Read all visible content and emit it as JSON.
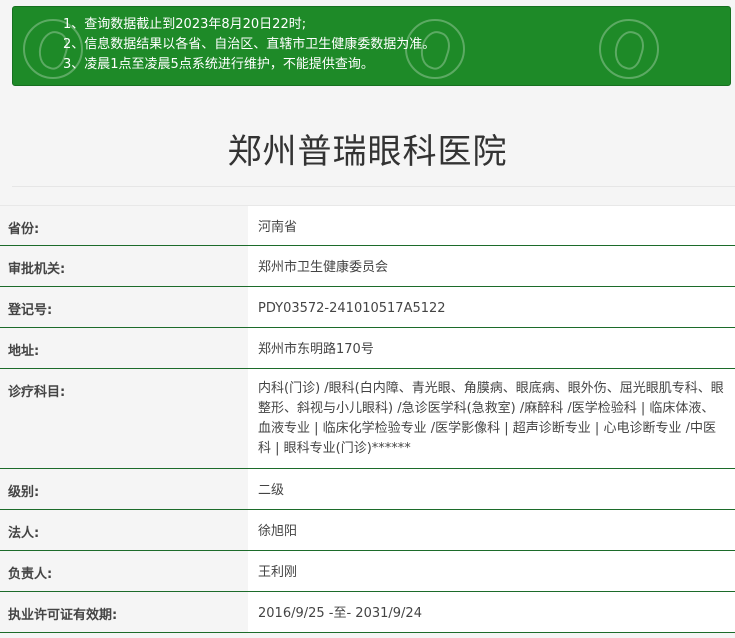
{
  "notice": {
    "lines": [
      "1、查询数据截止到2023年8月20日22时;",
      "2、信息数据结果以各省、自治区、直辖市卫生健康委数据为准。",
      "3、凌晨1点至凌晨5点系统进行维护，不能提供查询。"
    ]
  },
  "page_title": "郑州普瑞眼科医院",
  "rows": [
    {
      "label": "省份:",
      "value": "河南省"
    },
    {
      "label": "审批机关:",
      "value": "郑州市卫生健康委员会"
    },
    {
      "label": "登记号:",
      "value": "PDY03572-241010517A5122"
    },
    {
      "label": "地址:",
      "value": "郑州市东明路170号"
    },
    {
      "label": "诊疗科目:",
      "value": "内科(门诊) /眼科(白内障、青光眼、角膜病、眼底病、眼外伤、屈光眼肌专科、眼整形、斜视与小儿眼科) /急诊医学科(急救室) /麻醉科 /医学检验科 | 临床体液、血液专业 | 临床化学检验专业 /医学影像科 | 超声诊断专业 | 心电诊断专业 /中医科 | 眼科专业(门诊)******"
    },
    {
      "label": "级别:",
      "value": "二级"
    },
    {
      "label": "法人:",
      "value": "徐旭阳"
    },
    {
      "label": "负责人:",
      "value": "王利刚"
    },
    {
      "label": "执业许可证有效期:",
      "value": "2016/9/25 -至- 2031/9/24"
    }
  ],
  "colors": {
    "notice_bg": "#1e8a28",
    "row_border": "#1c6b2a"
  }
}
